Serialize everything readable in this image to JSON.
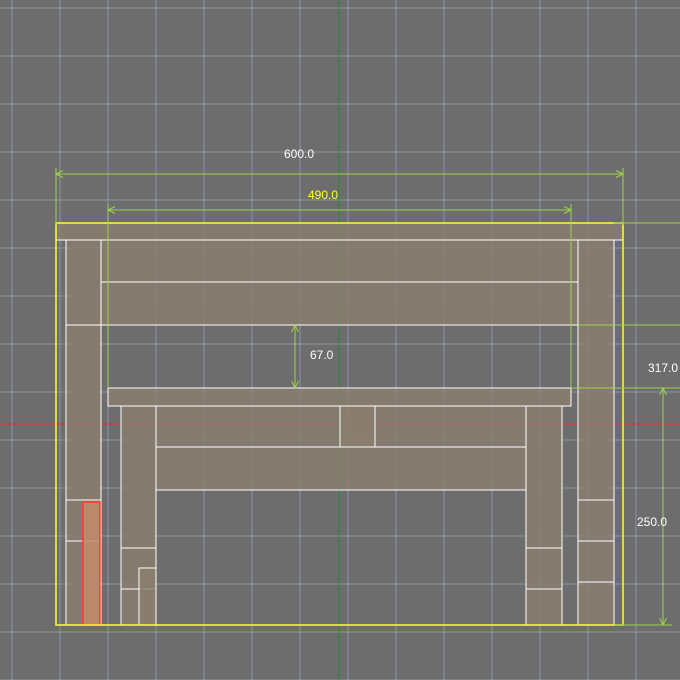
{
  "viewport": {
    "background": "#6d6d6d",
    "grid_color": "#8b93a3",
    "axis_x_color": "#d43a3a",
    "axis_y_color": "#2f8a3a"
  },
  "colors": {
    "selection_outline": "#ffff33",
    "dimension": "#9fd24a",
    "part_fill": "#8a7f6e",
    "part_edge": "#ffffff",
    "highlight_part_fill": "#c58b6c",
    "highlight_part_edge": "#ff3a2a",
    "label_white": "#ffffff",
    "label_yellow": "#ffff33"
  },
  "dimensions": {
    "overall_width": "600.0",
    "inner_width": "490.0",
    "gap_height": "67.0",
    "right_height": "317.0",
    "table_height": "250.0"
  }
}
